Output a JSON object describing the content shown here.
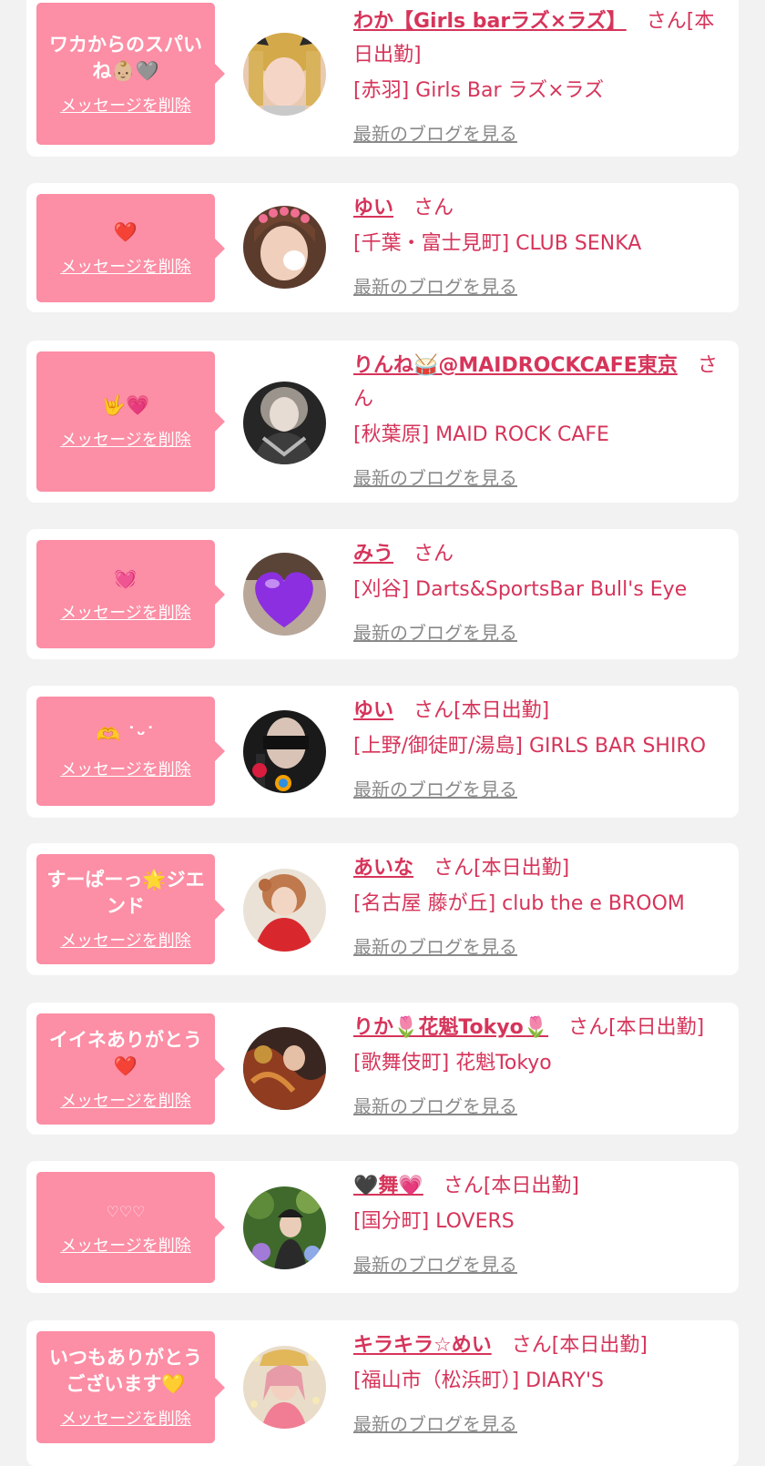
{
  "common": {
    "delete_label": "メッセージを削除",
    "honorific": "さん",
    "blog_label": "最新のブログを見る"
  },
  "colors": {
    "bubble": "#fc8ea5",
    "name": "#d6345a",
    "blog_link": "#8a8a8a",
    "background": "#f2f2f2"
  },
  "messages": [
    {
      "message": "ワカからのスパいね👶🏼🩶",
      "name": "わか【Girls barラズ×ラズ】",
      "status": "[本日出勤]",
      "shop": "[赤羽] Girls Bar ラズ×ラズ"
    },
    {
      "message": "❤️",
      "name": "ゆい",
      "status": "",
      "shop": "[千葉・富士見町] CLUB SENKA"
    },
    {
      "message": "🤟💗",
      "name": "りんね🥁@MAIDROCKCAFE東京",
      "status": "",
      "shop": "[秋葉原] MAID ROCK CAFE"
    },
    {
      "message": "💓",
      "name": "みう",
      "status": "",
      "shop": "[刈谷] Darts&SportsBar Bull's Eye"
    },
    {
      "message": "🫶 ˙ᵕ˙",
      "name": "ゆい",
      "status": "[本日出勤]",
      "shop": "[上野/御徒町/湯島] GIRLS BAR SHIRO"
    },
    {
      "message": "すーぱーっ🌟ジエンド",
      "name": "あいな",
      "status": "[本日出勤]",
      "shop": "[名古屋 藤が丘] club the e BROOM"
    },
    {
      "message": "イイネありがとう❤️",
      "name": "りか🌷花魁Tokyo🌷",
      "status": "[本日出勤]",
      "shop": "[歌舞伎町] 花魁Tokyo"
    },
    {
      "message": "♡♡♡",
      "name": "🖤舞💗",
      "status": "[本日出勤]",
      "shop": "[国分町] LOVERS"
    },
    {
      "message": "いつもありがとうございます💛",
      "name": "キラキラ☆めい",
      "status": "[本日出勤]",
      "shop": "[福山市（松浜町）] DIARY'S"
    }
  ]
}
